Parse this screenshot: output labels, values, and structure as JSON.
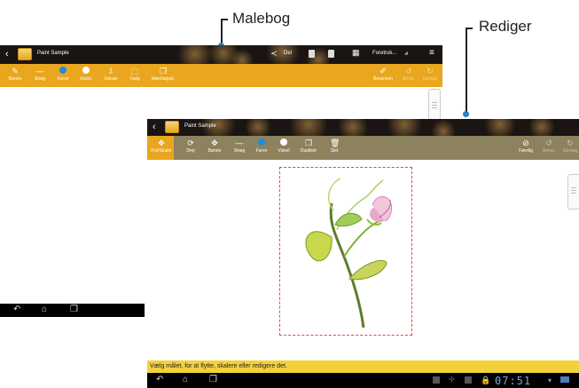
{
  "callouts": {
    "malebog": "Malebog",
    "rediger": "Rediger"
  },
  "screen1": {
    "title": "Paint Sample",
    "share_label": "Del",
    "prefs_label": "Foretruk...",
    "tools": [
      {
        "icon": "brush-icon",
        "label": "Børste"
      },
      {
        "icon": "stroke-icon",
        "label": "Strøg"
      },
      {
        "icon": "color-icon",
        "label": "Farve"
      },
      {
        "icon": "eraser-icon",
        "label": "Viskel."
      },
      {
        "icon": "import-icon",
        "label": "Indsæt"
      },
      {
        "icon": "select-icon",
        "label": "Vælg"
      },
      {
        "icon": "copy-icon",
        "label": "Mærktøjspl."
      }
    ],
    "right_tools": [
      {
        "icon": "clear-icon",
        "label": "Beskriven"
      },
      {
        "icon": "undo-icon",
        "label": "Annul."
      },
      {
        "icon": "redo-icon",
        "label": "Gentag"
      }
    ]
  },
  "screen2": {
    "title": "Paint Sample",
    "tools": [
      {
        "icon": "move-scale-icon",
        "label": "Flyt/Skaler"
      },
      {
        "icon": "rotate-icon",
        "label": "Drej"
      },
      {
        "icon": "brush-icon",
        "label": "Børste"
      },
      {
        "icon": "stroke-icon",
        "label": "Strøg"
      },
      {
        "icon": "color-icon",
        "label": "Farve"
      },
      {
        "icon": "eraser-icon",
        "label": "Viskel"
      },
      {
        "icon": "duplicate-icon",
        "label": "Duplikér"
      },
      {
        "icon": "delete-icon",
        "label": "Slet"
      }
    ],
    "right_tools": [
      {
        "icon": "done-icon",
        "label": "Færdig"
      },
      {
        "icon": "undo-icon",
        "label": "Annul."
      },
      {
        "icon": "redo-icon",
        "label": "Gentag"
      }
    ],
    "status": "Vælg målet, for at flytte, skalere eller redigere det.",
    "clock": "07:51"
  }
}
